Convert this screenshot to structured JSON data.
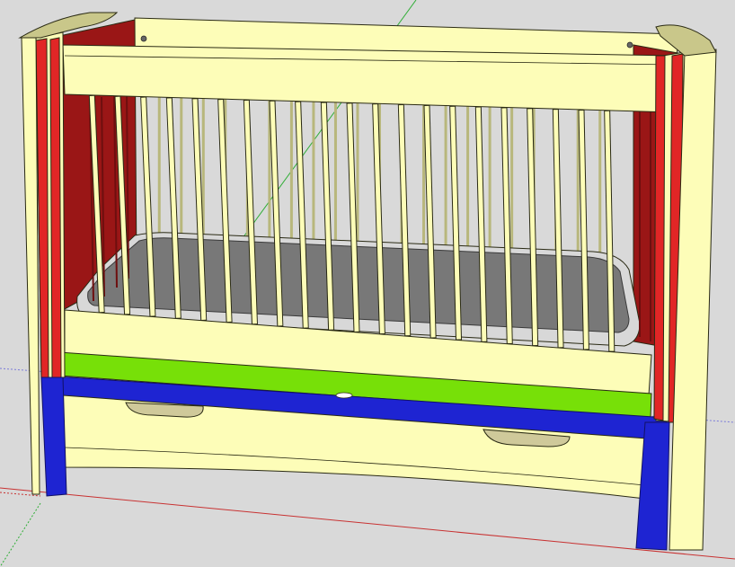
{
  "app": {
    "kind": "3d-modeling-viewport"
  },
  "viewport": {
    "background": "#d9d9d9"
  },
  "model": {
    "subject": "crib",
    "colors": {
      "wood": "#fdfdb8",
      "wood_shadow": "#e8e79e",
      "edge": "#2a2a14",
      "red_component": "#e12626",
      "dark_red_panel": "#9a1616",
      "green_component": "#77e008",
      "blue_component": "#1e24d2",
      "mattress": "#787878",
      "mattress_rim": "#d8d8d8"
    },
    "front_spindle_count": 21
  },
  "axes": {
    "red": "#c83232",
    "green": "#2fae36",
    "blue": "#5959d9"
  },
  "icons": {
    "model_name": "crib-model-icon"
  }
}
